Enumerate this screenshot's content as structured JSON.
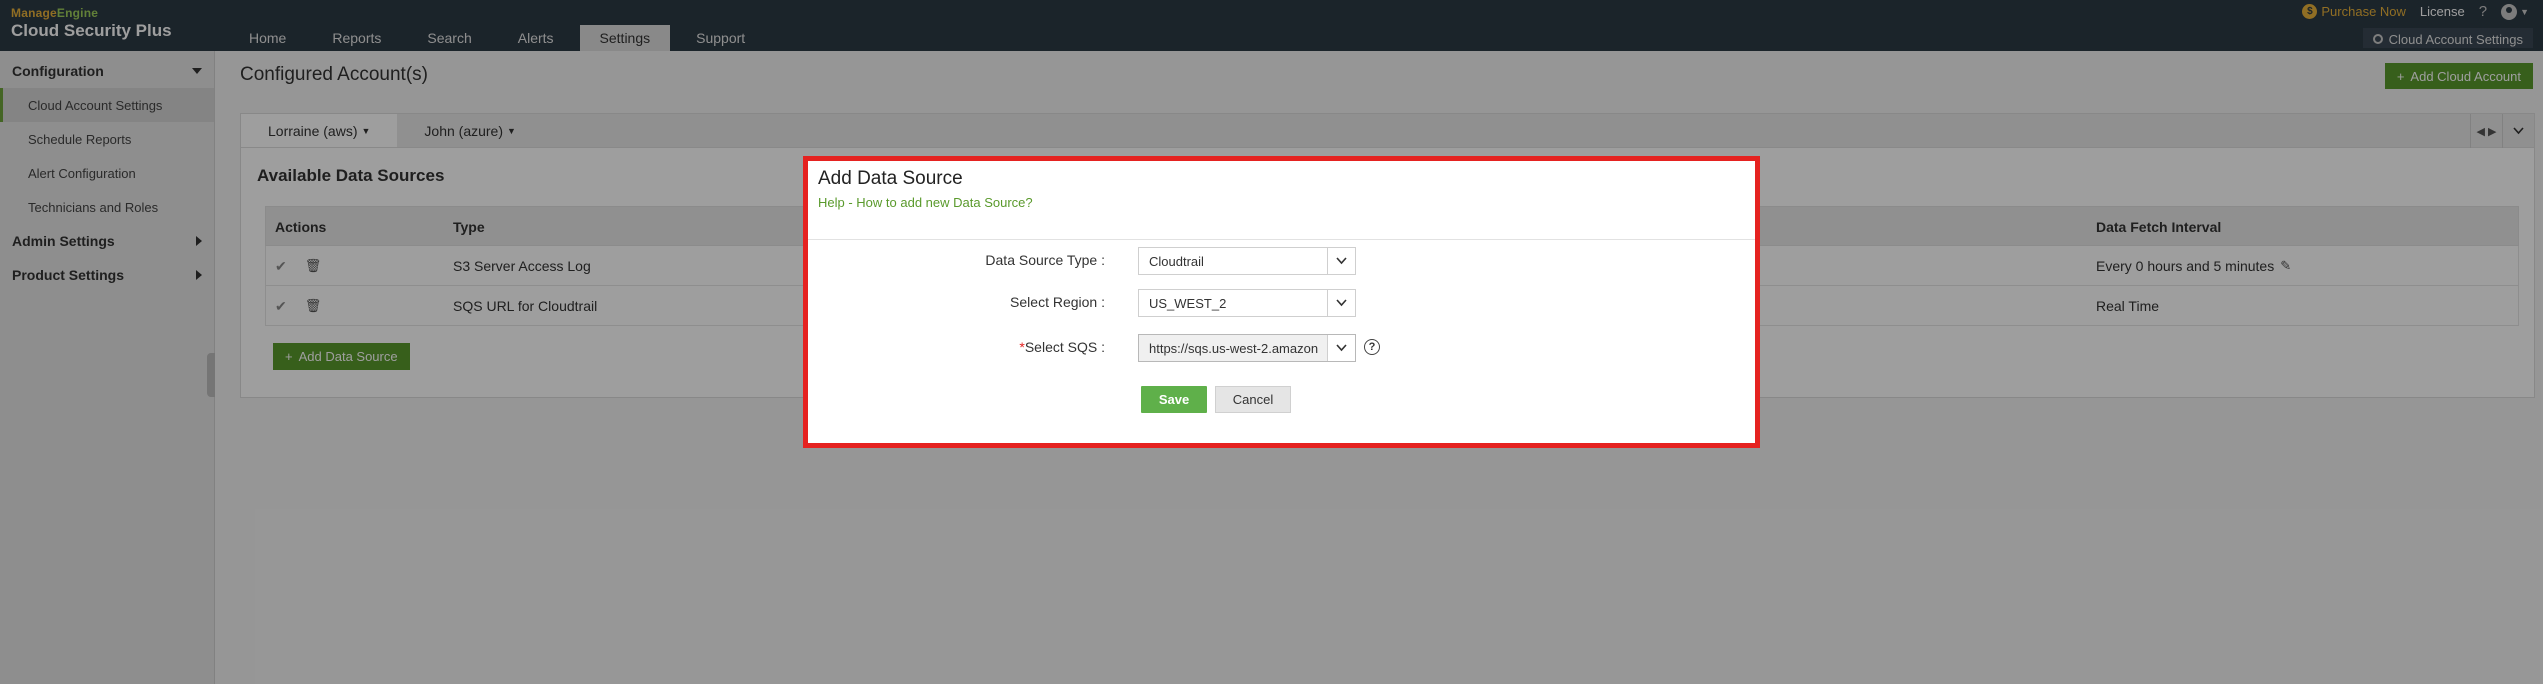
{
  "brand": {
    "vendor_a": "Manage",
    "vendor_b": "Engine",
    "product": "Cloud Security Plus"
  },
  "nav": {
    "tabs": [
      {
        "label": "Home",
        "active": false
      },
      {
        "label": "Reports",
        "active": false
      },
      {
        "label": "Search",
        "active": false
      },
      {
        "label": "Alerts",
        "active": false
      },
      {
        "label": "Settings",
        "active": true
      },
      {
        "label": "Support",
        "active": false
      }
    ]
  },
  "topright": {
    "purchase_label": "Purchase Now",
    "license_label": "License",
    "help_label": "?",
    "account_settings_label": "Cloud Account Settings"
  },
  "sidebar": {
    "configuration": "Configuration",
    "items": [
      {
        "label": "Cloud Account Settings",
        "active": true
      },
      {
        "label": "Schedule Reports",
        "active": false
      },
      {
        "label": "Alert Configuration",
        "active": false
      },
      {
        "label": "Technicians and Roles",
        "active": false
      }
    ],
    "admin_settings": "Admin Settings",
    "product_settings": "Product Settings"
  },
  "main": {
    "page_title": "Configured Account(s)",
    "add_cloud_account_label": "Add Cloud Account",
    "account_tabs": [
      {
        "label": "Lorraine (aws)",
        "active": true
      },
      {
        "label": "John (azure)",
        "active": false
      }
    ],
    "section_title": "Available Data Sources",
    "table": {
      "headers": {
        "actions": "Actions",
        "type": "Type",
        "interval": "Data Fetch Interval"
      },
      "rows": [
        {
          "type": "S3 Server Access Log",
          "interval": "Every 0 hours and 5 minutes",
          "editable": true
        },
        {
          "type": "SQS URL for Cloudtrail",
          "interval": "Real Time",
          "editable": false
        }
      ]
    },
    "add_data_source_label": "Add Data Source"
  },
  "modal": {
    "title": "Add Data Source",
    "help_link": "Help - How to add new Data Source?",
    "fields": {
      "type_label": "Data Source Type :",
      "type_value": "Cloudtrail",
      "region_label": "Select Region :",
      "region_value": "US_WEST_2",
      "sqs_required": "*",
      "sqs_label": "Select SQS :",
      "sqs_value": "https://sqs.us-west-2.amazon"
    },
    "save_label": "Save",
    "cancel_label": "Cancel"
  },
  "colors": {
    "topbar": "#2d3a45",
    "accent_green": "#5a9a2c",
    "highlight_red": "#e52220"
  }
}
